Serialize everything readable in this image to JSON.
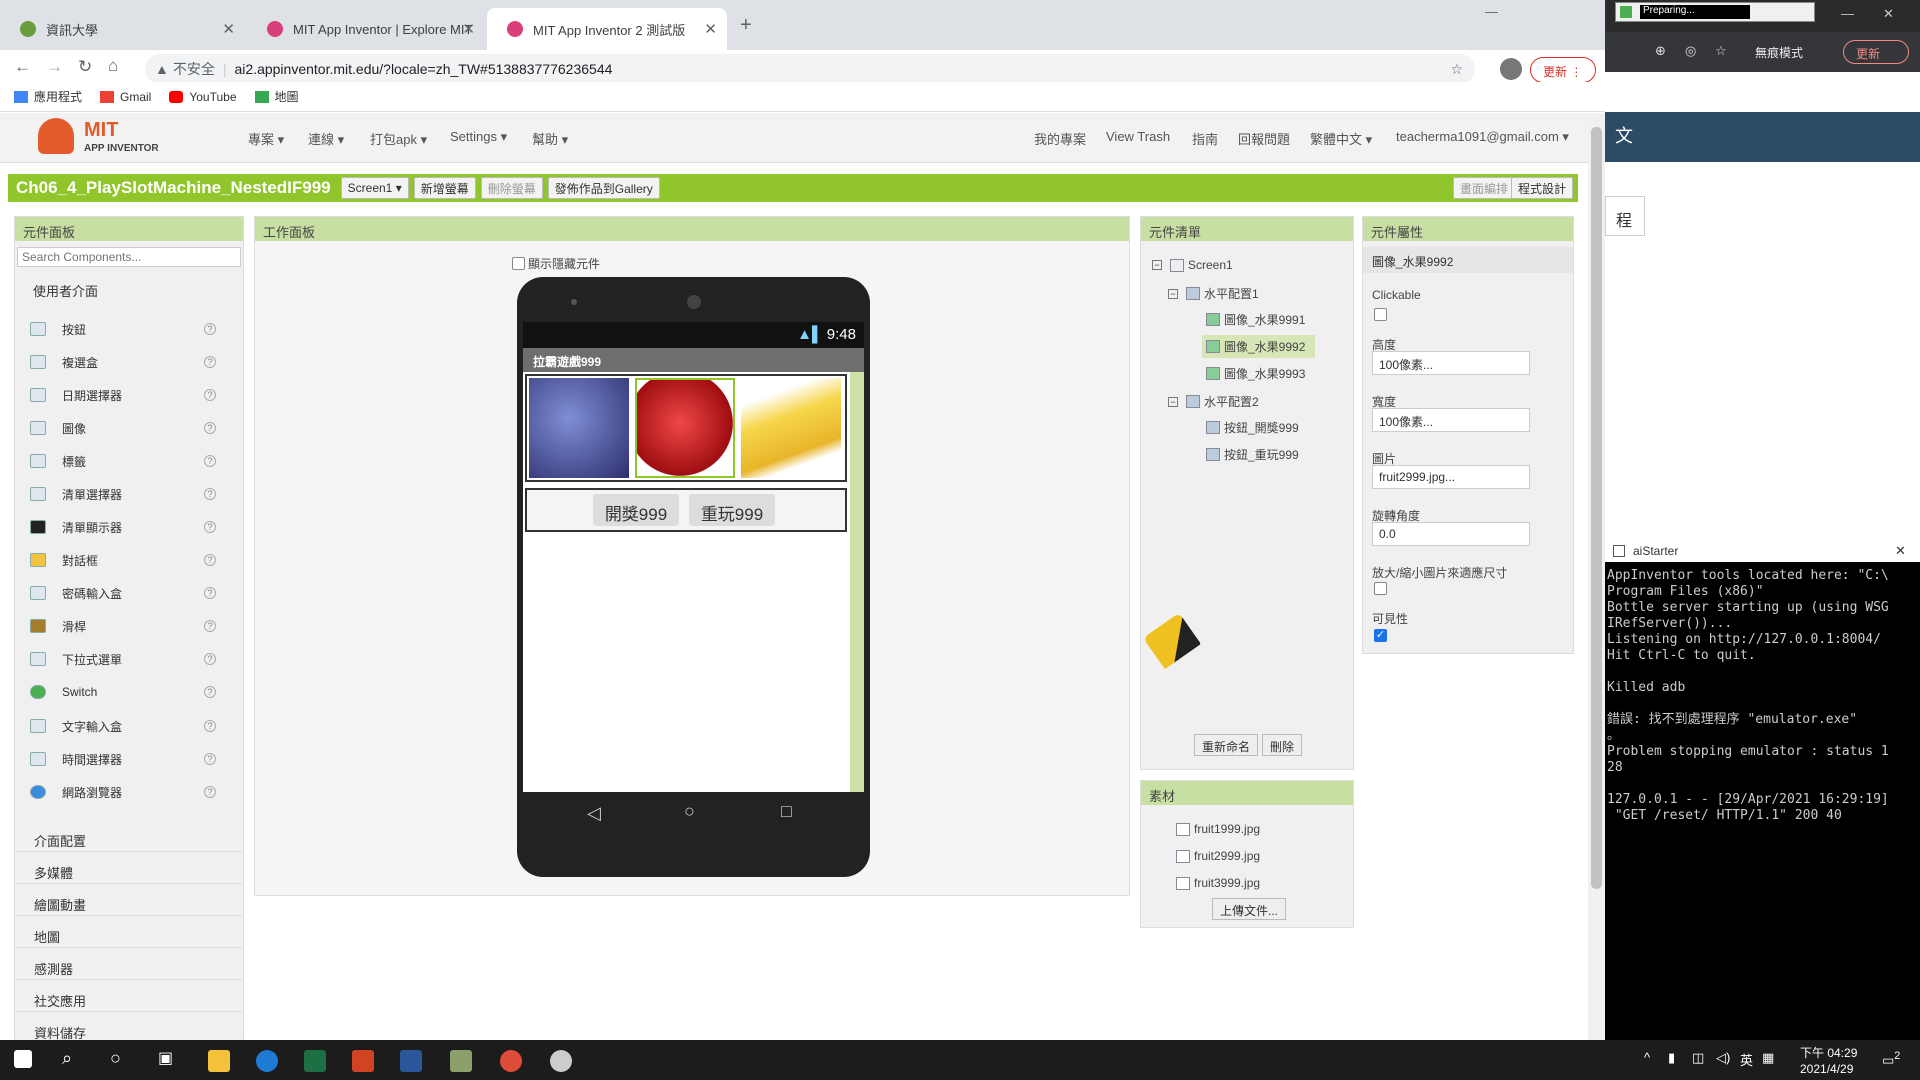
{
  "browser": {
    "tabs": [
      {
        "title": "資訊大學"
      },
      {
        "title": "MIT App Inventor | Explore MIT"
      },
      {
        "title": "MIT App Inventor 2 測試版"
      }
    ],
    "url_warning": "不安全",
    "url": "ai2.appinventor.mit.edu/?locale=zh_TW#5138837776236544",
    "bookmarks": [
      "應用程式",
      "Gmail",
      "YouTube",
      "地圖"
    ],
    "update_label": "更新",
    "preparing": "Preparing...",
    "incognito": "無痕模式",
    "right_update": "更新"
  },
  "app": {
    "logo_title": "MIT",
    "logo_sub": "APP INVENTOR",
    "menus": [
      "專案",
      "連線",
      "打包apk",
      "Settings",
      "幫助"
    ],
    "right_menus": [
      "我的專案",
      "View Trash",
      "指南",
      "回報問題",
      "繁體中文",
      "teacherma1091@gmail.com"
    ],
    "project_name": "Ch06_4_PlaySlotMachine_NestedIF999",
    "screen_select": "Screen1",
    "add_screen": "新增螢幕",
    "remove_screen": "刪除螢幕",
    "publish": "發佈作品到Gallery",
    "block_editor": "畫面編排",
    "designer": "程式設計"
  },
  "palette": {
    "header": "元件面板",
    "search_placeholder": "Search Components...",
    "category_open": "使用者介面",
    "items": [
      "按鈕",
      "複選盒",
      "日期選擇器",
      "圖像",
      "標籤",
      "清單選擇器",
      "清單顯示器",
      "對話框",
      "密碼輸入盒",
      "滑桿",
      "下拉式選單",
      "Switch",
      "文字輸入盒",
      "時間選擇器",
      "網路瀏覽器"
    ],
    "categories": [
      "介面配置",
      "多媒體",
      "繪圖動畫",
      "地圖",
      "感測器",
      "社交應用",
      "資料儲存"
    ]
  },
  "viewer": {
    "header": "工作面板",
    "show_hidden": "顯示隱藏元件",
    "status_time": "9:48",
    "app_title": "拉霸遊戲999",
    "btn_start": "開獎999",
    "btn_replay": "重玩999"
  },
  "components": {
    "header": "元件清單",
    "tree": [
      "Screen1",
      "水平配置1",
      "圖像_水果9991",
      "圖像_水果9992",
      "圖像_水果9993",
      "水平配置2",
      "按鈕_開獎999",
      "按鈕_重玩999"
    ],
    "rename": "重新命名",
    "delete": "刪除"
  },
  "media": {
    "header": "素材",
    "files": [
      "fruit1999.jpg",
      "fruit2999.jpg",
      "fruit3999.jpg"
    ],
    "upload": "上傳文件..."
  },
  "properties": {
    "header": "元件屬性",
    "selected": "圖像_水果9992",
    "clickable_label": "Clickable",
    "clickable": false,
    "height_label": "高度",
    "height_value": "100像素...",
    "width_label": "寬度",
    "width_value": "100像素...",
    "picture_label": "圖片",
    "picture_value": "fruit2999.jpg...",
    "rotation_label": "旋轉角度",
    "rotation_value": "0.0",
    "scale_label": "放大/縮小圖片來適應尺寸",
    "scale": false,
    "visible_label": "可見性",
    "visible": true
  },
  "side": {
    "tab_fragment": "文",
    "course": "程"
  },
  "aistarter": {
    "title": "aiStarter",
    "lines": [
      "AppInventor tools located here: \"C:\\",
      "Program Files (x86)\"",
      "Bottle server starting up (using WSG",
      "IRefServer())...",
      "Listening on http://127.0.0.1:8004/",
      "Hit Ctrl-C to quit.",
      "",
      "Killed adb",
      "",
      "錯誤: 找不到處理程序 \"emulator.exe\"",
      "。",
      "Problem stopping emulator : status 1",
      "28",
      "",
      "127.0.0.1 - - [29/Apr/2021 16:29:19]",
      " \"GET /reset/ HTTP/1.1\" 200 40"
    ]
  },
  "taskbar": {
    "ime": "英",
    "time": "下午 04:29",
    "date": "2021/4/29",
    "notif": "2"
  }
}
